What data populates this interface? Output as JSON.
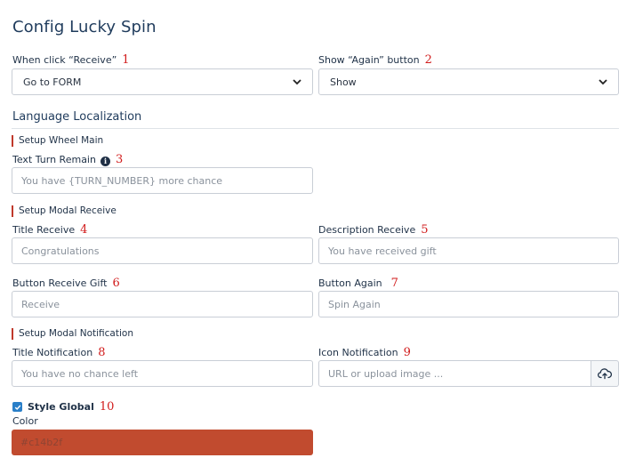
{
  "page": {
    "title": "Config Lucky Spin"
  },
  "receive_action": {
    "label": "When click “Receive”",
    "number": "1",
    "value": "Go to FORM"
  },
  "again_button": {
    "label": "Show “Again” button",
    "number": "2",
    "value": "Show"
  },
  "localization": {
    "heading": "Language Localization"
  },
  "wheel_main": {
    "heading": "Setup Wheel Main",
    "turn_remain": {
      "label": "Text Turn Remain",
      "number": "3",
      "placeholder": "You have {TURN_NUMBER} more chance"
    }
  },
  "modal_receive": {
    "heading": "Setup Modal Receive",
    "title_receive": {
      "label": "Title Receive",
      "number": "4",
      "placeholder": "Congratulations"
    },
    "description_receive": {
      "label": "Description Receive",
      "number": "5",
      "placeholder": "You have received gift"
    },
    "button_receive_gift": {
      "label": "Button Receive Gift",
      "number": "6",
      "placeholder": "Receive"
    },
    "button_again": {
      "label": "Button Again",
      "number": "7",
      "placeholder": "Spin Again"
    }
  },
  "modal_notification": {
    "heading": "Setup Modal Notification",
    "title_notification": {
      "label": "Title Notification",
      "number": "8",
      "placeholder": "You have no chance left"
    },
    "icon_notification": {
      "label": "Icon Notification",
      "number": "9",
      "placeholder": "URL or upload image ..."
    }
  },
  "style_global": {
    "label": "Style Global",
    "number": "10",
    "checked": true
  },
  "color": {
    "label": "Color",
    "value": "#c14b2f"
  },
  "icons": {
    "select_arrow": "chevron-down-icon",
    "info": "info-icon",
    "upload": "cloud-upload-icon",
    "check": "check-icon"
  },
  "colors": {
    "accent": "#c14b2f",
    "section_marker": "#c0392b",
    "checkbox": "#2a7fc8",
    "annotation": "#d11b1b"
  }
}
